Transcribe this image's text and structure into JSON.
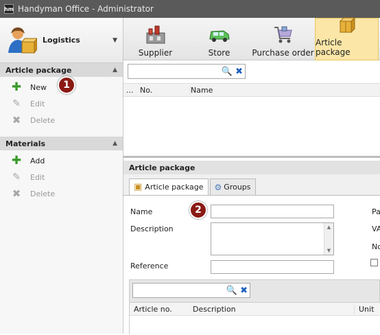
{
  "window": {
    "title": "Handyman Office - Administrator",
    "app_icon": "hm"
  },
  "module_selector": {
    "label": "Logistics"
  },
  "sidebar": {
    "article_package": {
      "header": "Article package",
      "actions": [
        {
          "label": "New",
          "icon": "plus-icon"
        },
        {
          "label": "Edit",
          "icon": "edit-icon"
        },
        {
          "label": "Delete",
          "icon": "delete-icon"
        }
      ]
    },
    "materials": {
      "header": "Materials",
      "actions": [
        {
          "label": "Add",
          "icon": "plus-icon"
        },
        {
          "label": "Edit",
          "icon": "edit-icon"
        },
        {
          "label": "Delete",
          "icon": "delete-icon"
        }
      ]
    }
  },
  "toolbar": {
    "items": [
      {
        "label": "Supplier",
        "icon": "factory-icon"
      },
      {
        "label": "Store",
        "icon": "van-icon"
      },
      {
        "label": "Purchase order",
        "icon": "cart-icon"
      },
      {
        "label": "Article package",
        "icon": "boxes-icon"
      }
    ],
    "active_index": 3
  },
  "list": {
    "search_value": "",
    "columns": [
      "...",
      "No.",
      "Name"
    ]
  },
  "detail": {
    "title": "Article package",
    "tabs": [
      {
        "label": "Article package",
        "icon": "box-icon"
      },
      {
        "label": "Groups",
        "icon": "groups-icon"
      }
    ],
    "fields": {
      "name_label": "Name",
      "name_value": "",
      "description_label": "Description",
      "description_value": "",
      "reference_label": "Reference",
      "reference_value": ""
    },
    "right_labels": [
      "Pa",
      "VA",
      "No"
    ],
    "subgrid": {
      "search_value": "",
      "columns": [
        "Article no.",
        "Description",
        "Unit"
      ]
    }
  },
  "annotations": [
    "1",
    "2"
  ],
  "colors": {
    "titlebar": "#5a5a5a",
    "active_tab": "#fbe6a7",
    "badge": "#8b1a14",
    "plus": "#3a9a2a",
    "clear_x": "#1f5fbf"
  }
}
